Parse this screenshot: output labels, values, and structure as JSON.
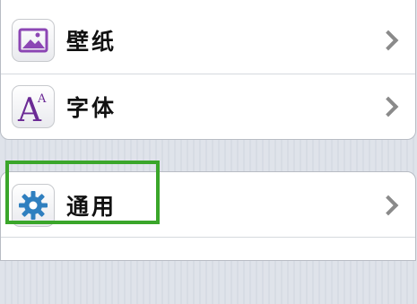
{
  "settings": {
    "rows": [
      {
        "label": "壁纸",
        "icon": "wallpaper-icon"
      },
      {
        "label": "字体",
        "icon": "font-icon",
        "glyph_big": "A",
        "glyph_small": "A"
      },
      {
        "label": "通用",
        "icon": "gear-icon"
      }
    ]
  },
  "colors": {
    "highlight": "#3aa62a",
    "wallpaper_icon": "#8c46b4",
    "font_icon": "#6b2a95",
    "gear_icon": "#2f7fbf"
  }
}
